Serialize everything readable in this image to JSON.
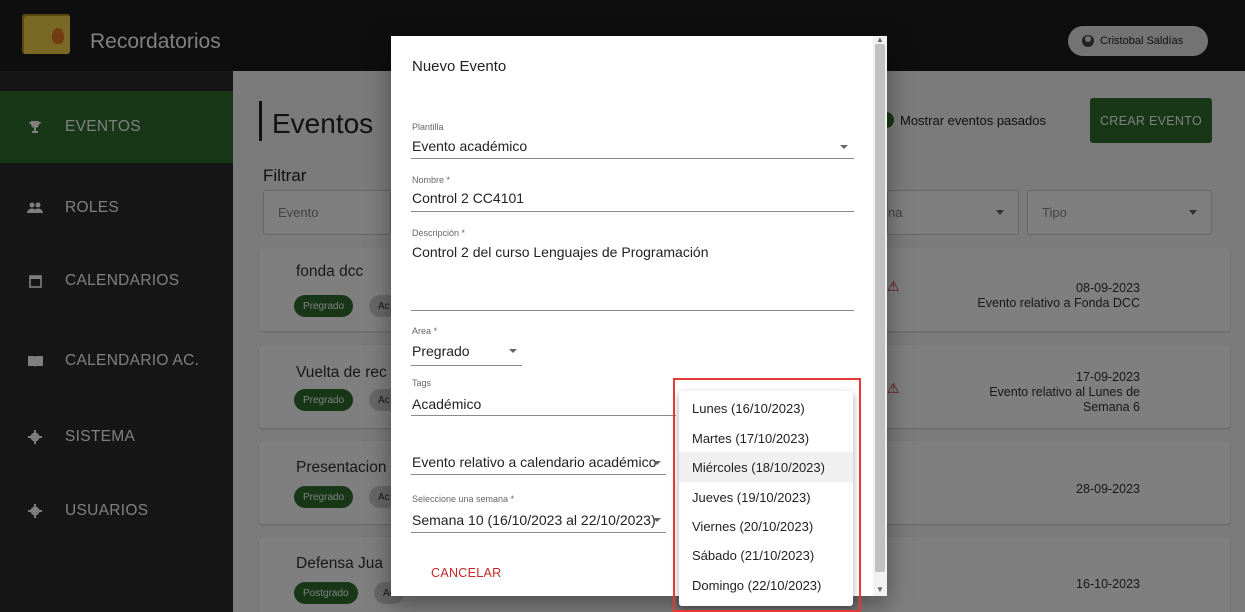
{
  "app": {
    "title": "Recordatorios",
    "user_name": "Cristobal Saldías"
  },
  "sidebar": {
    "items": [
      {
        "label": "EVENTOS",
        "icon": "trophy-icon",
        "active": true
      },
      {
        "label": "ROLES",
        "icon": "group-icon",
        "active": false
      },
      {
        "label": "CALENDARIOS",
        "icon": "calendar-icon",
        "active": false
      },
      {
        "label": "CALENDARIO AC.",
        "icon": "book-icon",
        "active": false
      },
      {
        "label": "SISTEMA",
        "icon": "gear-icon",
        "active": false
      },
      {
        "label": "USUARIOS",
        "icon": "gear-icon",
        "active": false
      }
    ]
  },
  "page": {
    "title": "Eventos",
    "filter_heading": "Filtrar",
    "filter_event_placeholder": "Evento",
    "filter_date_fragment": "na",
    "filter_type_placeholder": "Tipo",
    "show_past_label": "Mostrar eventos pasados",
    "create_button": "CREAR EVENTO"
  },
  "events": [
    {
      "title": "fonda dcc",
      "chips": [
        "Pregrado",
        "Ac"
      ],
      "date": "08-09-2023",
      "detail_lines": [
        "Evento relativo a Fonda DCC"
      ],
      "warning": true
    },
    {
      "title": "Vuelta de rec",
      "chips": [
        "Pregrado",
        "Ac"
      ],
      "date": "17-09-2023",
      "detail_lines": [
        "Evento relativo al Lunes de",
        "Semana 6"
      ],
      "warning": true
    },
    {
      "title": "Presentacion",
      "chips": [
        "Pregrado",
        "Ac"
      ],
      "date": "28-09-2023",
      "detail_lines": [],
      "warning": false
    },
    {
      "title": "Defensa Jua",
      "chips": [
        "Postgrado",
        "Ac"
      ],
      "date": "16-10-2023",
      "detail_lines": [],
      "warning": false
    }
  ],
  "modal": {
    "title": "Nuevo Evento",
    "plantilla": {
      "label": "Plantilla",
      "value": "Evento académico"
    },
    "nombre": {
      "label": "Nombre *",
      "value": "Control 2 CC4101"
    },
    "descripcion": {
      "label": "Descripción *",
      "value": "Control 2 del curso Lenguajes de Programación"
    },
    "area": {
      "label": "Area *",
      "value": "Pregrado"
    },
    "tags": {
      "label": "Tags",
      "value": "Académico"
    },
    "relative": {
      "value": "Evento relativo a calendario académico"
    },
    "semana": {
      "label": "Seleccione una semana *",
      "value": "Semana 10 (16/10/2023 al 22/10/2023)"
    },
    "cancel_button": "CANCELAR"
  },
  "day_menu": {
    "options": [
      "Lunes (16/10/2023)",
      "Martes (17/10/2023)",
      "Miércoles (18/10/2023)",
      "Jueves (19/10/2023)",
      "Viernes (20/10/2023)",
      "Sábado (21/10/2023)",
      "Domingo (22/10/2023)"
    ],
    "hovered": "Miércoles (18/10/2023)"
  },
  "colors": {
    "accent_green": "#2e6f2e",
    "sidebar_bg": "#2c2c2c",
    "topbar_bg": "#1d1d1d",
    "cancel_red": "#c62828",
    "highlight_red": "#e53935"
  }
}
